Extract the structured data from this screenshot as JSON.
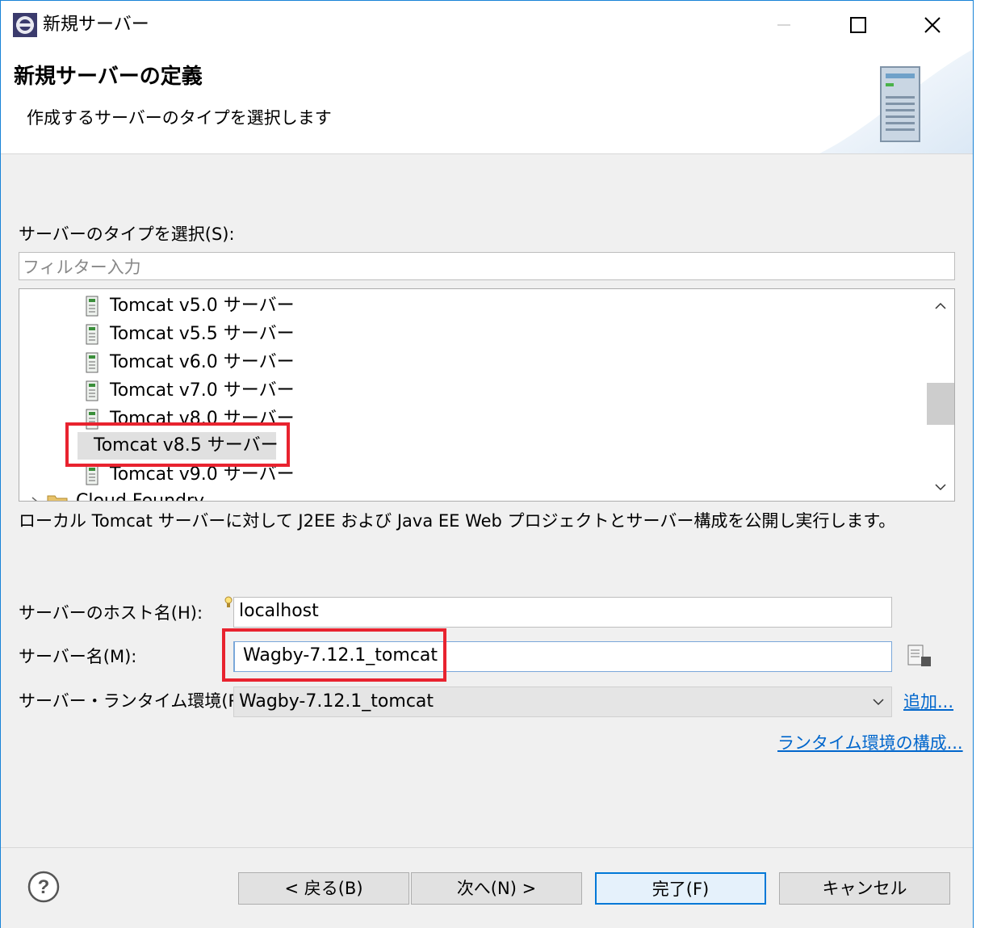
{
  "window": {
    "title": "新規サーバー"
  },
  "header": {
    "title": "新規サーバーの定義",
    "description": "作成するサーバーのタイプを選択します"
  },
  "server_type": {
    "label": "サーバーのタイプを選択(S):",
    "filter_placeholder": "フィルター入力",
    "tree_items": [
      {
        "label": "Tomcat v5.0 サーバー",
        "selected": false
      },
      {
        "label": "Tomcat v5.5 サーバー",
        "selected": false
      },
      {
        "label": "Tomcat v6.0 サーバー",
        "selected": false
      },
      {
        "label": "Tomcat v7.0 サーバー",
        "selected": false
      },
      {
        "label": "Tomcat v8.0 サーバー",
        "selected": false
      },
      {
        "label": "Tomcat v8.5 サーバー",
        "selected": true
      },
      {
        "label": "Tomcat v9.0 サーバー",
        "selected": false
      },
      {
        "label": "Cloud Foundry",
        "selected": false
      }
    ],
    "description": "ローカル Tomcat サーバーに対して J2EE および Java EE Web プロジェクトとサーバー構成を公開し実行します。"
  },
  "form": {
    "host_label": "サーバーのホスト名(H):",
    "host_value": "localhost",
    "name_label": "サーバー名(M):",
    "name_value": "Wagby-7.12.1_tomcat",
    "runtime_label": "サーバー・ランタイム環境(R):",
    "runtime_value": "Wagby-7.12.1_tomcat",
    "add_link": "追加...",
    "configure_link": "ランタイム環境の構成..."
  },
  "buttons": {
    "back": "< 戻る(B)",
    "next": "次へ(N) >",
    "finish": "完了(F)",
    "cancel": "キャンセル"
  },
  "colors": {
    "highlight": "#e8232f",
    "accent": "#0078d7",
    "link": "#0066cc"
  }
}
